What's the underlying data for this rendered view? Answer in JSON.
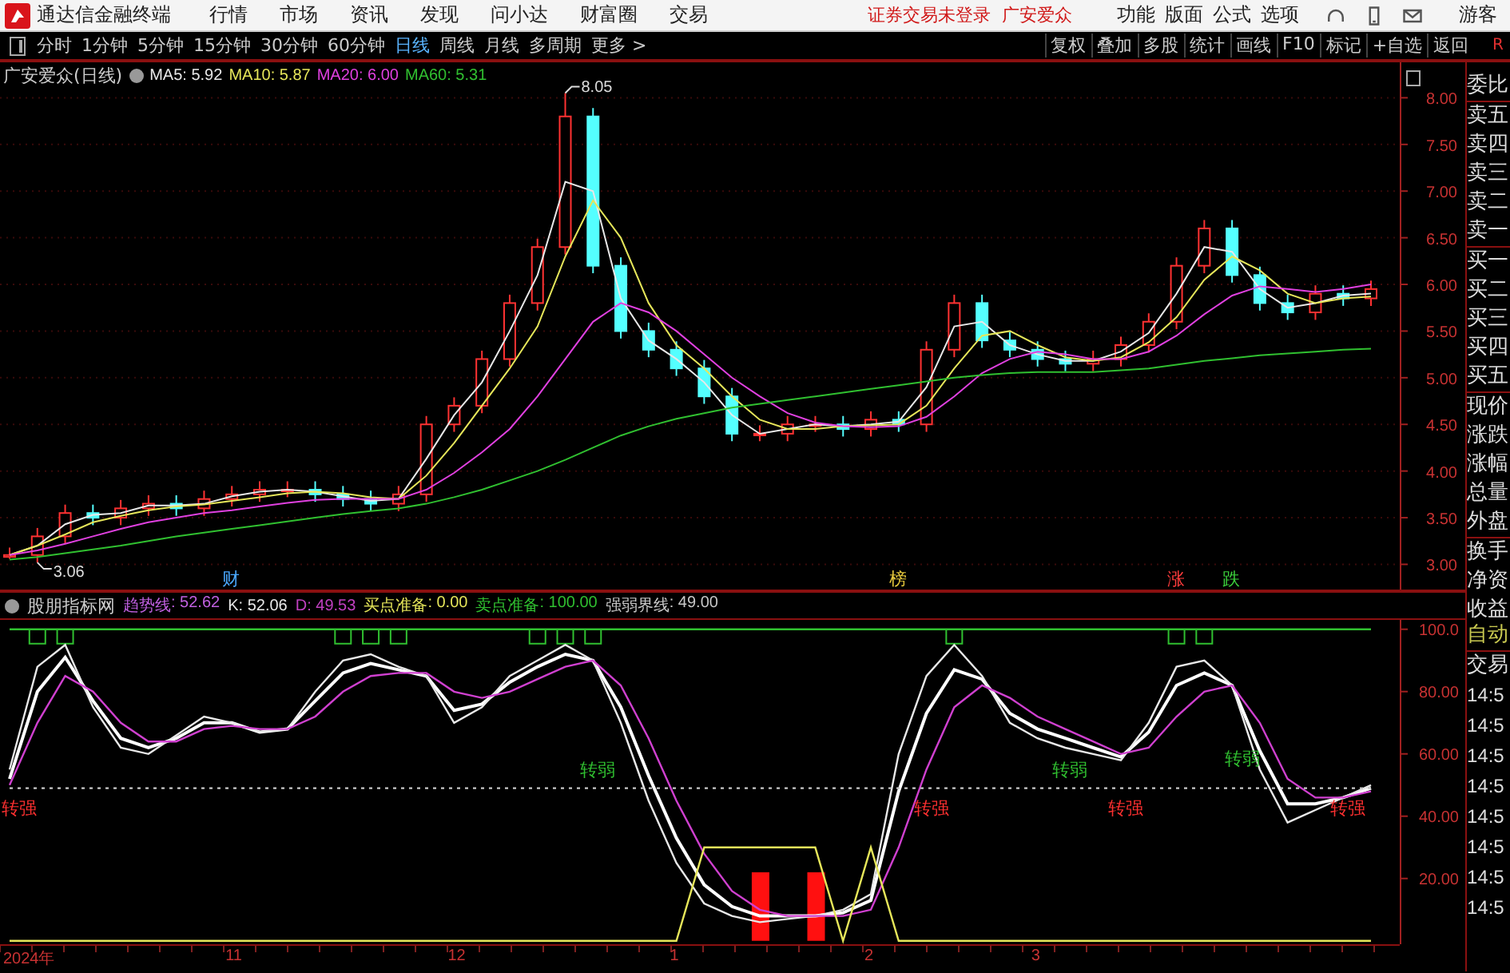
{
  "app": {
    "title": "通达信金融终端",
    "menu": [
      "行情",
      "市场",
      "资讯",
      "发现",
      "问小达",
      "财富圈",
      "交易"
    ],
    "notice": "证券交易未登录  广安爱众",
    "menu_right": [
      "功能",
      "版面",
      "公式",
      "选项"
    ],
    "user": "游客"
  },
  "toolbar": {
    "periods": [
      {
        "label": "分时",
        "selected": false
      },
      {
        "label": "1分钟",
        "selected": false
      },
      {
        "label": "5分钟",
        "selected": false
      },
      {
        "label": "15分钟",
        "selected": false
      },
      {
        "label": "30分钟",
        "selected": false
      },
      {
        "label": "60分钟",
        "selected": false
      },
      {
        "label": "日线",
        "selected": true
      },
      {
        "label": "周线",
        "selected": false
      },
      {
        "label": "月线",
        "selected": false
      },
      {
        "label": "多周期",
        "selected": false
      },
      {
        "label": "更多 >",
        "selected": false
      }
    ],
    "actions": [
      "复权",
      "叠加",
      "多股",
      "统计",
      "画线",
      "F10",
      "标记",
      "+自选",
      "返回"
    ],
    "corner": "R"
  },
  "price_chart": {
    "title": "广安爱众(日线)",
    "legend_values": [
      ": 5.92",
      ": 5.87",
      ": 6.00",
      ": 5.31"
    ],
    "chart_data": {
      "type": "candlestick",
      "grid": true,
      "ylim": [
        2.73,
        8.38
      ],
      "yticks": [
        {
          "value": 3,
          "label": "3.00"
        },
        {
          "value": 3.5,
          "label": "3.50"
        },
        {
          "value": 4,
          "label": "4.00"
        },
        {
          "value": 4.5,
          "label": "4.50"
        },
        {
          "value": 5,
          "label": "5.00"
        },
        {
          "value": 5.5,
          "label": "5.50"
        },
        {
          "value": 6,
          "label": "6.00"
        },
        {
          "value": 6.5,
          "label": "6.50"
        },
        {
          "value": 7,
          "label": "7.00"
        },
        {
          "value": 7.5,
          "label": "7.50"
        },
        {
          "value": 8,
          "label": "8.00"
        }
      ],
      "ohlc": [
        [
          3.08,
          3.18,
          3.06,
          3.1
        ],
        [
          3.1,
          3.39,
          3.02,
          3.3
        ],
        [
          3.3,
          3.64,
          3.22,
          3.55
        ],
        [
          3.55,
          3.64,
          3.42,
          3.5
        ],
        [
          3.5,
          3.69,
          3.42,
          3.6
        ],
        [
          3.6,
          3.74,
          3.52,
          3.65
        ],
        [
          3.65,
          3.74,
          3.52,
          3.6
        ],
        [
          3.6,
          3.79,
          3.52,
          3.7
        ],
        [
          3.7,
          3.84,
          3.62,
          3.75
        ],
        [
          3.75,
          3.89,
          3.67,
          3.8
        ],
        [
          3.8,
          3.89,
          3.72,
          3.8
        ],
        [
          3.8,
          3.89,
          3.67,
          3.75
        ],
        [
          3.75,
          3.84,
          3.62,
          3.7
        ],
        [
          3.7,
          3.79,
          3.57,
          3.65
        ],
        [
          3.65,
          3.84,
          3.57,
          3.75
        ],
        [
          3.75,
          4.59,
          3.67,
          4.5
        ],
        [
          4.5,
          4.79,
          4.42,
          4.7
        ],
        [
          4.7,
          5.29,
          4.62,
          5.2
        ],
        [
          5.2,
          5.89,
          5.12,
          5.8
        ],
        [
          5.8,
          6.49,
          5.72,
          6.4
        ],
        [
          6.4,
          8.05,
          6.32,
          7.8
        ],
        [
          7.8,
          7.89,
          6.12,
          6.2
        ],
        [
          6.2,
          6.29,
          5.42,
          5.5
        ],
        [
          5.5,
          5.59,
          5.22,
          5.3
        ],
        [
          5.3,
          5.39,
          5.02,
          5.1
        ],
        [
          5.1,
          5.19,
          4.72,
          4.8
        ],
        [
          4.8,
          4.89,
          4.32,
          4.4
        ],
        [
          4.4,
          4.49,
          4.32,
          4.4
        ],
        [
          4.4,
          4.59,
          4.32,
          4.5
        ],
        [
          4.5,
          4.59,
          4.42,
          4.5
        ],
        [
          4.5,
          4.59,
          4.37,
          4.45
        ],
        [
          4.45,
          4.64,
          4.37,
          4.55
        ],
        [
          4.55,
          4.64,
          4.42,
          4.5
        ],
        [
          4.5,
          5.39,
          4.42,
          5.3
        ],
        [
          5.3,
          5.89,
          5.22,
          5.8
        ],
        [
          5.8,
          5.89,
          5.32,
          5.4
        ],
        [
          5.4,
          5.49,
          5.22,
          5.3
        ],
        [
          5.3,
          5.39,
          5.12,
          5.2
        ],
        [
          5.2,
          5.29,
          5.07,
          5.15
        ],
        [
          5.15,
          5.29,
          5.07,
          5.2
        ],
        [
          5.2,
          5.44,
          5.12,
          5.35
        ],
        [
          5.35,
          5.69,
          5.27,
          5.6
        ],
        [
          5.6,
          6.29,
          5.52,
          6.2
        ],
        [
          6.2,
          6.69,
          6.12,
          6.6
        ],
        [
          6.6,
          6.69,
          6.02,
          6.1
        ],
        [
          6.1,
          6.19,
          5.72,
          5.8
        ],
        [
          5.8,
          5.89,
          5.62,
          5.7
        ],
        [
          5.7,
          5.99,
          5.62,
          5.9
        ],
        [
          5.9,
          5.99,
          5.77,
          5.85
        ],
        [
          5.85,
          6.04,
          5.77,
          5.95
        ]
      ],
      "series": [
        {
          "name": "MA5",
          "type": "line",
          "color": "#e8e8e8",
          "values": [
            3.1,
            3.2,
            3.43,
            3.53,
            3.55,
            3.63,
            3.63,
            3.65,
            3.73,
            3.78,
            3.8,
            3.78,
            3.73,
            3.68,
            3.7,
            4.13,
            4.6,
            4.95,
            5.5,
            6.1,
            7.1,
            7.0,
            5.85,
            5.4,
            5.2,
            4.95,
            4.6,
            4.4,
            4.45,
            4.5,
            4.48,
            4.5,
            4.53,
            4.9,
            5.55,
            5.6,
            5.35,
            5.25,
            5.18,
            5.18,
            5.28,
            5.48,
            5.9,
            6.4,
            6.35,
            5.95,
            5.75,
            5.8,
            5.88,
            5.9
          ]
        },
        {
          "name": "MA10",
          "type": "line",
          "color": "#e6e65a",
          "values": [
            3.1,
            3.2,
            3.32,
            3.45,
            3.52,
            3.58,
            3.62,
            3.64,
            3.68,
            3.72,
            3.76,
            3.78,
            3.76,
            3.72,
            3.7,
            3.95,
            4.3,
            4.7,
            5.1,
            5.55,
            6.3,
            6.9,
            6.5,
            5.8,
            5.35,
            5.1,
            4.8,
            4.55,
            4.45,
            4.45,
            4.48,
            4.49,
            4.5,
            4.7,
            5.1,
            5.45,
            5.5,
            5.35,
            5.22,
            5.18,
            5.22,
            5.38,
            5.65,
            6.05,
            6.3,
            6.15,
            5.9,
            5.8,
            5.85,
            5.87
          ]
        },
        {
          "name": "MA20",
          "type": "line",
          "color": "#e040e0",
          "values": [
            3.1,
            3.15,
            3.22,
            3.3,
            3.38,
            3.45,
            3.5,
            3.55,
            3.58,
            3.62,
            3.66,
            3.69,
            3.7,
            3.7,
            3.7,
            3.8,
            3.98,
            4.2,
            4.45,
            4.8,
            5.2,
            5.6,
            5.8,
            5.7,
            5.5,
            5.25,
            5.0,
            4.8,
            4.62,
            4.52,
            4.48,
            4.47,
            4.48,
            4.58,
            4.8,
            5.05,
            5.2,
            5.28,
            5.25,
            5.2,
            5.2,
            5.28,
            5.45,
            5.68,
            5.88,
            5.98,
            5.95,
            5.92,
            5.95,
            6.0
          ]
        },
        {
          "name": "MA60",
          "type": "line",
          "color": "#30c030",
          "values": [
            3.05,
            3.08,
            3.12,
            3.16,
            3.2,
            3.25,
            3.3,
            3.34,
            3.38,
            3.42,
            3.46,
            3.5,
            3.54,
            3.57,
            3.6,
            3.65,
            3.72,
            3.8,
            3.9,
            4.0,
            4.12,
            4.25,
            4.38,
            4.48,
            4.56,
            4.62,
            4.68,
            4.72,
            4.76,
            4.8,
            4.84,
            4.88,
            4.92,
            4.96,
            5.0,
            5.03,
            5.05,
            5.06,
            5.06,
            5.06,
            5.08,
            5.1,
            5.14,
            5.18,
            5.21,
            5.24,
            5.26,
            5.28,
            5.3,
            5.31
          ]
        }
      ],
      "annotations": [
        {
          "text": "8.05"
        },
        {
          "text": "3.06"
        }
      ]
    },
    "events": [
      {
        "text": "财",
        "color": "#4aa8ff"
      },
      {
        "text": "榜",
        "color": "#e6c83c"
      },
      {
        "text": "涨",
        "color": "#ff3c3c"
      },
      {
        "text": "跌",
        "color": "#3cd23c"
      }
    ]
  },
  "indicator": {
    "title": "股朋指标网",
    "legend_values": [
      ": 52.62",
      ": 52.06",
      ": 49.53",
      ": 0.00",
      ": 100.00",
      ": 49.00"
    ],
    "chart_data": {
      "type": "line",
      "ylim": [
        -1.1,
        103
      ],
      "yticks": [
        {
          "value": 20,
          "label": "20.00"
        },
        {
          "value": 40,
          "label": "40.00"
        },
        {
          "value": 60,
          "label": "60.00"
        },
        {
          "value": 80,
          "label": "80.00"
        },
        {
          "value": 100,
          "label": "100.0"
        }
      ],
      "series": [
        {
          "name": "趋势线",
          "color": "#ffffff",
          "values": [
            52,
            80,
            91,
            77,
            65,
            62,
            65,
            70,
            70,
            67,
            68,
            77,
            86,
            89,
            87,
            85,
            74,
            76,
            83,
            88,
            92,
            90,
            75,
            53,
            33,
            18,
            11,
            8,
            8,
            8,
            9,
            13,
            48,
            73,
            87,
            84,
            73,
            68,
            65,
            62,
            59,
            67,
            82,
            86,
            82,
            61,
            44,
            44,
            46,
            49
          ]
        },
        {
          "name": "K",
          "color": "#e8e8e8",
          "values": [
            55,
            88,
            95,
            75,
            62,
            60,
            66,
            72,
            70,
            67,
            68,
            80,
            90,
            92,
            88,
            85,
            70,
            75,
            85,
            90,
            95,
            90,
            70,
            45,
            25,
            12,
            8,
            6,
            7,
            8,
            10,
            15,
            60,
            85,
            95,
            85,
            70,
            65,
            62,
            60,
            58,
            70,
            88,
            90,
            82,
            55,
            38,
            42,
            46,
            50
          ]
        },
        {
          "name": "D",
          "color": "#d040d0",
          "values": [
            50,
            70,
            85,
            80,
            70,
            64,
            64,
            68,
            69,
            68,
            68,
            72,
            80,
            85,
            86,
            86,
            80,
            78,
            80,
            84,
            88,
            90,
            82,
            65,
            45,
            28,
            16,
            10,
            8,
            8,
            8,
            10,
            30,
            55,
            75,
            82,
            78,
            72,
            68,
            64,
            60,
            62,
            72,
            80,
            82,
            70,
            52,
            46,
            46,
            48
          ]
        },
        {
          "name": "买点准备",
          "color": "#e6e65a",
          "values": [
            0,
            0,
            0,
            0,
            0,
            0,
            0,
            0,
            0,
            0,
            0,
            0,
            0,
            0,
            0,
            0,
            0,
            0,
            0,
            0,
            0,
            0,
            0,
            0,
            0,
            30,
            30,
            30,
            30,
            30,
            0,
            30,
            0,
            0,
            0,
            0,
            0,
            0,
            0,
            0,
            0,
            0,
            0,
            0,
            0,
            0,
            0,
            0,
            0,
            0
          ]
        },
        {
          "name": "卖点准备",
          "color": "#30c030",
          "values": [
            100,
            100,
            100,
            100,
            100,
            100,
            100,
            100,
            100,
            100,
            100,
            100,
            100,
            100,
            100,
            100,
            100,
            100,
            100,
            100,
            100,
            100,
            100,
            100,
            100,
            100,
            100,
            100,
            100,
            100,
            100,
            100,
            100,
            100,
            100,
            100,
            100,
            100,
            100,
            100,
            100,
            100,
            100,
            100,
            100,
            100,
            100,
            100,
            100,
            100
          ]
        },
        {
          "name": "强弱界线",
          "color": "#c8c8c8",
          "line_style": "dashed",
          "values": [
            49,
            49,
            49,
            49,
            49,
            49,
            49,
            49,
            49,
            49,
            49,
            49,
            49,
            49,
            49,
            49,
            49,
            49,
            49,
            49,
            49,
            49,
            49,
            49,
            49,
            49,
            49,
            49,
            49,
            49,
            49,
            49,
            49,
            49,
            49,
            49,
            49,
            49,
            49,
            49,
            49,
            49,
            49,
            49,
            49,
            49,
            49,
            49,
            49,
            49
          ]
        },
        {
          "type": "bar",
          "color": "#ff1010",
          "values": [
            null,
            null,
            null,
            null,
            null,
            null,
            null,
            null,
            null,
            null,
            null,
            null,
            null,
            null,
            null,
            null,
            null,
            null,
            null,
            null,
            null,
            null,
            null,
            null,
            null,
            null,
            null,
            22,
            null,
            22,
            null,
            null,
            null,
            null,
            null,
            null,
            null,
            null,
            null,
            null,
            null,
            null,
            null,
            null,
            null,
            null,
            null,
            null,
            null,
            null
          ]
        }
      ]
    },
    "signals": [
      {
        "text": "转强",
        "kind": "strong"
      },
      {
        "text": "转弱",
        "kind": "weak"
      },
      {
        "text": "转强",
        "kind": "strong"
      },
      {
        "text": "转弱",
        "kind": "weak"
      },
      {
        "text": "转强",
        "kind": "strong"
      },
      {
        "text": "转弱",
        "kind": "weak"
      },
      {
        "text": "转强",
        "kind": "strong"
      }
    ]
  },
  "date_axis": [
    "2024年",
    "11",
    "12",
    "1",
    "2",
    "3"
  ],
  "quote_panel": [
    "委比",
    "卖五",
    "卖四",
    "卖三",
    "卖二",
    "卖一",
    "买一",
    "买二",
    "买三",
    "买四",
    "买五",
    "现价",
    "涨跌",
    "涨幅",
    "总量",
    "外盘",
    "换手",
    "净资",
    "收益"
  ],
  "trade_panel": {
    "header": [
      "自动",
      "交易"
    ],
    "times": [
      "14:5",
      "14:5",
      "14:5",
      "14:5",
      "14:5",
      "14:5",
      "14:5",
      "14:5"
    ]
  }
}
